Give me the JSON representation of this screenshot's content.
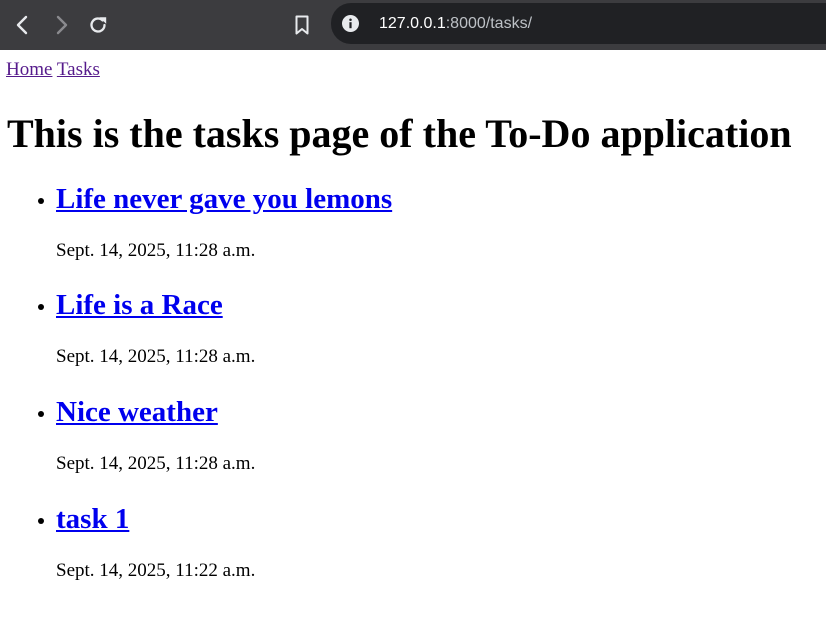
{
  "browser": {
    "url_host": "127.0.0.1",
    "url_path": ":8000/tasks/"
  },
  "nav": {
    "home_label": "Home",
    "tasks_label": "Tasks"
  },
  "page": {
    "title": "This is the tasks page of the To-Do application"
  },
  "tasks": [
    {
      "title": "Life never gave you lemons",
      "date": "Sept. 14, 2025, 11:28 a.m."
    },
    {
      "title": "Life is a Race",
      "date": "Sept. 14, 2025, 11:28 a.m."
    },
    {
      "title": "Nice weather",
      "date": "Sept. 14, 2025, 11:28 a.m."
    },
    {
      "title": "task 1",
      "date": "Sept. 14, 2025, 11:22 a.m."
    }
  ],
  "icons": {
    "back": "chevron-left-icon",
    "forward": "chevron-right-icon",
    "reload": "reload-icon",
    "bookmark": "bookmark-icon",
    "site_info": "info-icon"
  },
  "colors": {
    "link": "#0000ee",
    "visited_link": "#551a8b",
    "toolbar": "#3c3c3f",
    "urlbar": "#202124"
  }
}
